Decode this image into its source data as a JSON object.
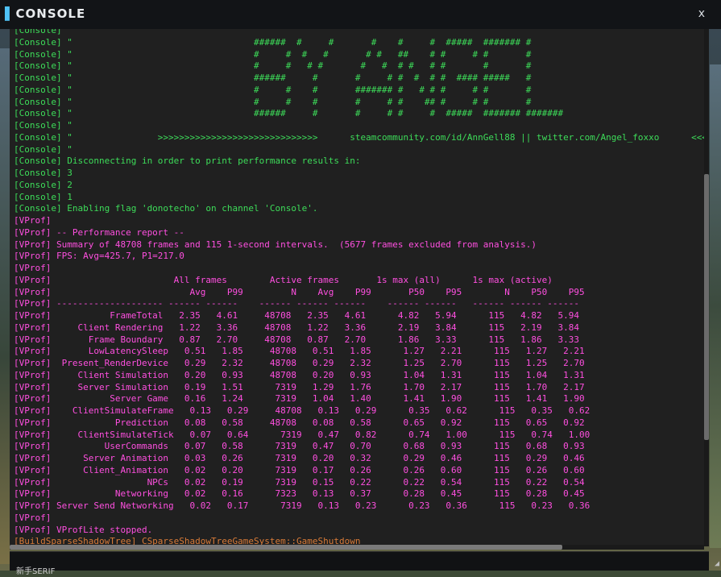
{
  "window": {
    "title": "CONSOLE",
    "close_label": "x"
  },
  "input": {
    "placeholder": ""
  },
  "bottom_text": "新手SERIF",
  "colors": {
    "console": "#3ddc59",
    "vprof": "#ff4fe0",
    "other": "#d97b38",
    "background": "#202020"
  },
  "lines": [
    {
      "t": "[Console] \"",
      "c": "console"
    },
    {
      "t": "[Console] \"                                  ######  #     #       #    #     #  #####  ####### #",
      "c": "console"
    },
    {
      "t": "[Console] \"                                  #     #  #   #       # #   ##    # #     # #       #",
      "c": "console"
    },
    {
      "t": "[Console] \"                                  #     #   # #       #   #  # #   # #       #       #",
      "c": "console"
    },
    {
      "t": "[Console] \"                                  ######     #       #     # #  #  # #  #### #####   #",
      "c": "console"
    },
    {
      "t": "[Console] \"                                  #     #    #       ####### #   # # #     # #       #",
      "c": "console"
    },
    {
      "t": "[Console] \"                                  #     #    #       #     # #    ## #     # #       #",
      "c": "console"
    },
    {
      "t": "[Console] \"                                  ######     #       #     # #     #  #####  ####### #######",
      "c": "console"
    },
    {
      "t": "[Console] \"",
      "c": "console"
    },
    {
      "t": "[Console] \"                >>>>>>>>>>>>>>>>>>>>>>>>>>>>>>      steamcommunity.com/id/AnnGell88 || twitter.com/Angel_foxxo      <<<<<<<<<<<<<<<<<<<<<<<<<<<<<<",
      "c": "console"
    },
    {
      "t": "[Console] \"",
      "c": "console"
    },
    {
      "t": "[Console] Disconnecting in order to print performance results in:",
      "c": "console"
    },
    {
      "t": "[Console] 3",
      "c": "console"
    },
    {
      "t": "[Console] 2",
      "c": "console"
    },
    {
      "t": "[Console] 1",
      "c": "console"
    },
    {
      "t": "[Console] Enabling flag 'donotecho' on channel 'Console'.",
      "c": "console"
    },
    {
      "t": "[VProf]",
      "c": "vprof"
    },
    {
      "t": "[VProf] -- Performance report --",
      "c": "vprof"
    },
    {
      "t": "[VProf] Summary of 48708 frames and 115 1-second intervals.  (5677 frames excluded from analysis.)",
      "c": "vprof"
    },
    {
      "t": "[VProf] FPS: Avg=425.7, P1=217.0",
      "c": "vprof"
    },
    {
      "t": "[VProf]",
      "c": "vprof"
    },
    {
      "t": "[VProf]                       All frames        Active frames       1s max (all)      1s max (active)",
      "c": "vprof"
    },
    {
      "t": "[VProf]                          Avg    P99         N    Avg    P99       P50    P95        N    P50    P95",
      "c": "vprof"
    },
    {
      "t": "[VProf] -------------------- ------ ------    ------ ------ ------    ------ ------   ------ ------ ------",
      "c": "vprof"
    },
    {
      "t": "[VProf]           FrameTotal   2.35   4.61     48708   2.35   4.61      4.82   5.94      115   4.82   5.94",
      "c": "vprof"
    },
    {
      "t": "[VProf]     Client Rendering   1.22   3.36     48708   1.22   3.36      2.19   3.84      115   2.19   3.84",
      "c": "vprof"
    },
    {
      "t": "[VProf]       Frame Boundary   0.87   2.70     48708   0.87   2.70      1.86   3.33      115   1.86   3.33",
      "c": "vprof"
    },
    {
      "t": "[VProf]       LowLatencySleep   0.51   1.85     48708   0.51   1.85      1.27   2.21      115   1.27   2.21",
      "c": "vprof"
    },
    {
      "t": "[VProf]  Present_RenderDevice   0.29   2.32     48708   0.29   2.32      1.25   2.70      115   1.25   2.70",
      "c": "vprof"
    },
    {
      "t": "[VProf]     Client Simulation   0.20   0.93     48708   0.20   0.93      1.04   1.31      115   1.04   1.31",
      "c": "vprof"
    },
    {
      "t": "[VProf]     Server Simulation   0.19   1.51      7319   1.29   1.76      1.70   2.17      115   1.70   2.17",
      "c": "vprof"
    },
    {
      "t": "[VProf]           Server Game   0.16   1.24      7319   1.04   1.40      1.41   1.90      115   1.41   1.90",
      "c": "vprof"
    },
    {
      "t": "[VProf]    ClientSimulateFrame   0.13   0.29     48708   0.13   0.29      0.35   0.62      115   0.35   0.62",
      "c": "vprof"
    },
    {
      "t": "[VProf]            Prediction   0.08   0.58     48708   0.08   0.58      0.65   0.92      115   0.65   0.92",
      "c": "vprof"
    },
    {
      "t": "[VProf]     ClientSimulateTick   0.07   0.64      7319   0.47   0.82      0.74   1.00      115   0.74   1.00",
      "c": "vprof"
    },
    {
      "t": "[VProf]          UserCommands   0.07   0.58      7319   0.47   0.70      0.68   0.93      115   0.68   0.93",
      "c": "vprof"
    },
    {
      "t": "[VProf]      Server Animation   0.03   0.26      7319   0.20   0.32      0.29   0.46      115   0.29   0.46",
      "c": "vprof"
    },
    {
      "t": "[VProf]      Client_Animation   0.02   0.20      7319   0.17   0.26      0.26   0.60      115   0.26   0.60",
      "c": "vprof"
    },
    {
      "t": "[VProf]                  NPCs   0.02   0.19      7319   0.15   0.22      0.22   0.54      115   0.22   0.54",
      "c": "vprof"
    },
    {
      "t": "[VProf]            Networking   0.02   0.16      7323   0.13   0.37      0.28   0.45      115   0.28   0.45",
      "c": "vprof"
    },
    {
      "t": "[VProf] Server Send Networking   0.02   0.17      7319   0.13   0.23      0.23   0.36      115   0.23   0.36",
      "c": "vprof"
    },
    {
      "t": "[VProf]",
      "c": "vprof"
    },
    {
      "t": "[VProf] VProfLite stopped.",
      "c": "vprof"
    },
    {
      "t": "[BuildSparseShadowTree] CSparseShadowTreeGameSystem::GameShutdown",
      "c": "other"
    }
  ]
}
